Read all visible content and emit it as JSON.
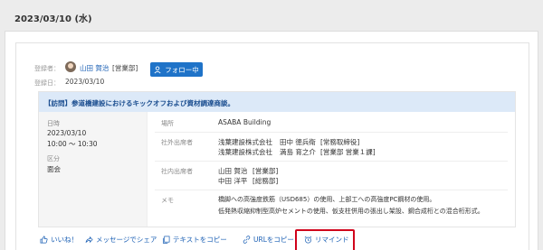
{
  "date": "2023/03/10 (水)",
  "registrant": {
    "label": "登録者：",
    "name": "山田 賀治",
    "dept": "[営業部]",
    "follow_button": "フォロー中"
  },
  "registered_date": {
    "label": "登録日：",
    "value": "2023/03/10"
  },
  "visit": {
    "title": "【訪問】参道橋建設におけるキックオフおよび資材調達商談。",
    "datetime_label": "日時",
    "date": "2023/03/10",
    "time": "10:00 ～ 10:30",
    "type_label": "区分",
    "type_value": "面会",
    "place_label": "場所",
    "place_value": "ASABA Building",
    "external_label": "社外出席者",
    "external_attendees": [
      {
        "company": "浅葉建設株式会社",
        "name": "田中 徳兵衛",
        "role": "[常務取締役]"
      },
      {
        "company": "浅葉建設株式会社",
        "name": "満島 育之介",
        "role": "[営業部 営業１課]"
      }
    ],
    "internal_label": "社内出席者",
    "internal_attendees": [
      {
        "name": "山田 賀治",
        "role": "[営業部]"
      },
      {
        "name": "中田 洋平",
        "role": "[総務部]"
      }
    ],
    "memo_label": "メモ",
    "memo_lines": [
      "橋脚への高強度鉄筋（USD685）の使用、上部工への高強度PC鋼材の使用。",
      "低発熱収縮抑制型高炉セメントの使用、仮支柱併用の張出し架設、鋼合成桁との混合桁形式。"
    ]
  },
  "actions": {
    "like": "いいね！",
    "share": "メッセージでシェア",
    "copy_text": "テキストをコピー",
    "copy_url": "URLをコピー",
    "remind": "リマインド"
  },
  "colors": {
    "accent": "#1f73c8",
    "link": "#1a5fb4",
    "title_bg": "#dce9f8",
    "highlight": "#d0021b"
  }
}
